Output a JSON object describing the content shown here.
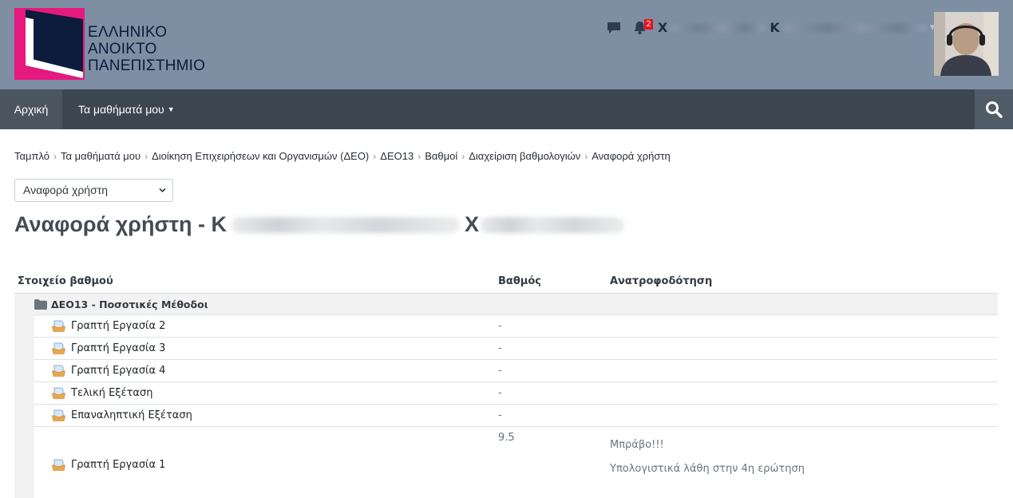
{
  "header": {
    "logo_lines": [
      "ΕΛΛΗΝΙΚΟ",
      "ΑΝΟΙΚΤΟ",
      "ΠΑΝΕΠΙΣΤΗΜΙΟ"
    ],
    "notifications_count": "2",
    "user_first_initial": "Χ",
    "user_last_initial": "Κ"
  },
  "nav": {
    "home_label": "Αρχική",
    "my_courses_label": "Τα μαθήματά μου"
  },
  "breadcrumb": [
    "Ταμπλό",
    "Τα μαθήματά μου",
    "Διοίκηση Επιχειρήσεων και Οργανισμών (ΔΕΟ)",
    "ΔΕΟ13",
    "Βαθμοί",
    "Διαχείριση βαθμολογιών",
    "Αναφορά χρήστη"
  ],
  "report_select": {
    "selected": "Αναφορά χρήστη"
  },
  "page_title": {
    "prefix": "Αναφορά χρήστη - Κ",
    "middle_initial": "Χ"
  },
  "table": {
    "headers": {
      "item": "Στοιχείο βαθμού",
      "grade": "Βαθμός",
      "feedback": "Ανατροφοδότηση"
    },
    "category": "ΔΕΟ13 - Ποσοτικές Μέθοδοι",
    "rows": [
      {
        "name": "Γραπτή Εργασία 2",
        "grade": "-",
        "feedback": ""
      },
      {
        "name": "Γραπτή Εργασία 3",
        "grade": "-",
        "feedback": ""
      },
      {
        "name": "Γραπτή Εργασία 4",
        "grade": "-",
        "feedback": ""
      },
      {
        "name": "Τελική Εξέταση",
        "grade": "-",
        "feedback": ""
      },
      {
        "name": "Επαναληπτική Εξέταση",
        "grade": "-",
        "feedback": ""
      },
      {
        "name": "Γραπτή Εργασία 1",
        "grade": "9.5",
        "feedback_lines": [
          "Μπράβο!!!",
          "Υπολογιστικά λάθη στην 4η ερώτηση"
        ]
      }
    ]
  },
  "colors": {
    "header_bg": "#7e8ea3",
    "nav_bg": "#3b4650",
    "logo_magenta": "#e5197e",
    "logo_navy": "#0d1b3d"
  },
  "icons": {
    "chat": "chat-icon",
    "bell": "bell-icon",
    "search": "search-icon",
    "folder": "folder-icon",
    "assignment": "assignment-icon"
  }
}
